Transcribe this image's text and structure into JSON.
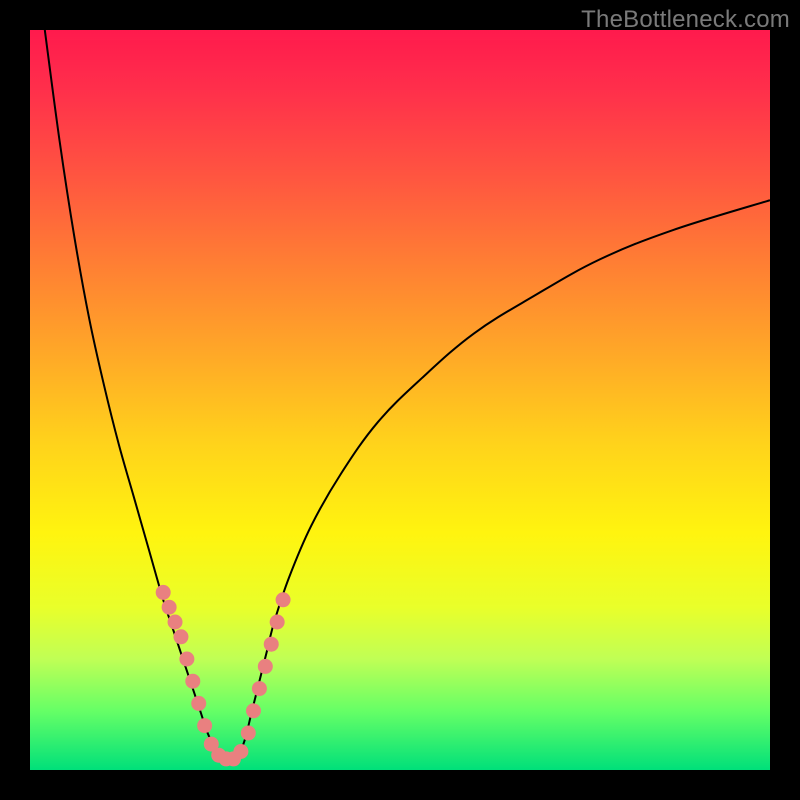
{
  "watermark": "TheBottleneck.com",
  "colors": {
    "gradient_top": "#ff1a4d",
    "gradient_bottom": "#00e07a",
    "curve": "#000000",
    "dot": "#e98080",
    "frame": "#000000"
  },
  "chart_data": {
    "type": "line",
    "title": "",
    "xlabel": "",
    "ylabel": "",
    "xlim": [
      0,
      100
    ],
    "ylim": [
      0,
      100
    ],
    "grid": false,
    "legend": false,
    "series": [
      {
        "name": "left-curve",
        "x": [
          2,
          4,
          6,
          8,
          10,
          12,
          14,
          16,
          18,
          19,
          20,
          21,
          22,
          23,
          24,
          25,
          26
        ],
        "y": [
          100,
          85,
          72,
          61,
          52,
          44,
          37,
          30,
          23,
          20,
          17,
          14,
          11,
          8,
          5,
          3,
          1.5
        ]
      },
      {
        "name": "right-curve",
        "x": [
          28,
          29,
          30,
          31,
          32,
          33,
          35,
          38,
          42,
          47,
          53,
          60,
          68,
          77,
          87,
          100
        ],
        "y": [
          1.5,
          4,
          8,
          12,
          16,
          20,
          26,
          33,
          40,
          47,
          53,
          59,
          64,
          69,
          73,
          77
        ]
      }
    ],
    "markers": {
      "left_branch": [
        {
          "x": 18.0,
          "y": 24
        },
        {
          "x": 18.8,
          "y": 22
        },
        {
          "x": 19.6,
          "y": 20
        },
        {
          "x": 20.4,
          "y": 18
        },
        {
          "x": 21.2,
          "y": 15
        },
        {
          "x": 22.0,
          "y": 12
        },
        {
          "x": 22.8,
          "y": 9
        },
        {
          "x": 23.6,
          "y": 6
        },
        {
          "x": 24.5,
          "y": 3.5
        },
        {
          "x": 25.5,
          "y": 2
        }
      ],
      "bottom_bridge": [
        {
          "x": 26.5,
          "y": 1.5
        },
        {
          "x": 27.5,
          "y": 1.5
        }
      ],
      "right_branch": [
        {
          "x": 28.5,
          "y": 2.5
        },
        {
          "x": 29.5,
          "y": 5
        },
        {
          "x": 30.2,
          "y": 8
        },
        {
          "x": 31.0,
          "y": 11
        },
        {
          "x": 31.8,
          "y": 14
        },
        {
          "x": 32.6,
          "y": 17
        },
        {
          "x": 33.4,
          "y": 20
        },
        {
          "x": 34.2,
          "y": 23
        }
      ]
    }
  }
}
